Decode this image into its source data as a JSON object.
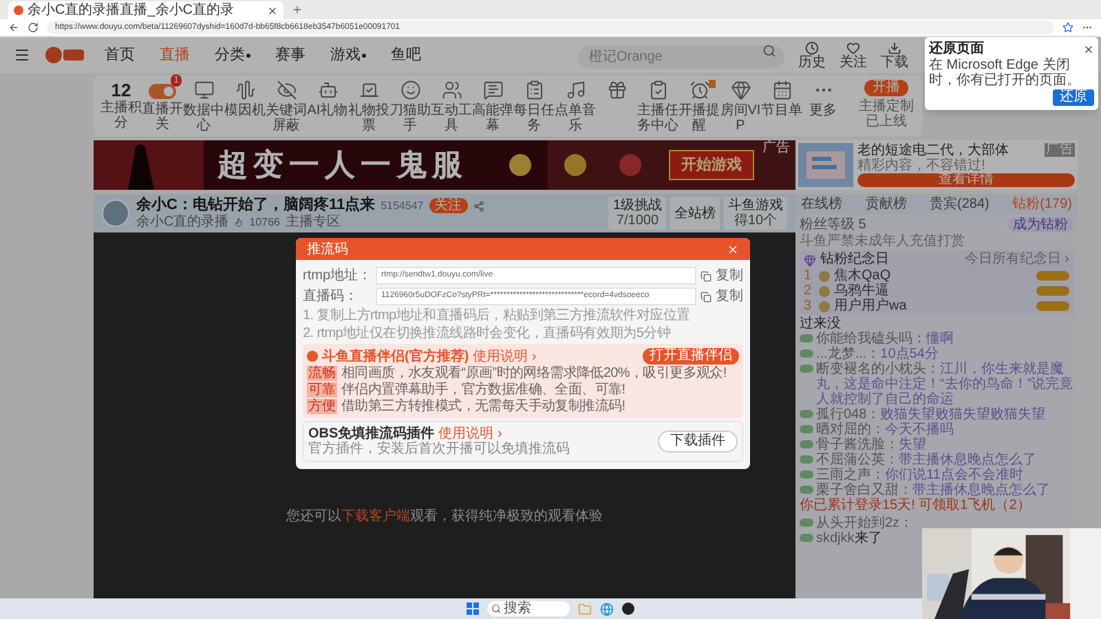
{
  "browser": {
    "tab_title": "余小C直的录播直播_余小C直的录",
    "address": "https://www.douyu.com/beta/11269607dyshid=160d7d-bb65f8cb6618eb3547b6051e00091701"
  },
  "restore_popup": {
    "title": "还原页面",
    "message": "在 Microsoft Edge 关闭时，你有已打开的页面。",
    "button": "还原"
  },
  "nav": {
    "items": [
      {
        "label": "首页",
        "selected": false,
        "has_menu": false
      },
      {
        "label": "直播",
        "selected": true,
        "has_menu": false
      },
      {
        "label": "分类",
        "selected": false,
        "has_menu": true
      },
      {
        "label": "赛事",
        "selected": false,
        "has_menu": false
      },
      {
        "label": "游戏",
        "selected": false,
        "has_menu": true
      },
      {
        "label": "鱼吧",
        "selected": false,
        "has_menu": false
      }
    ],
    "search": {
      "placeholder": "橙记Orange"
    },
    "actions": [
      "历史",
      "关注",
      "下载"
    ]
  },
  "tools": {
    "score": "12",
    "score_label": "主播积分",
    "items": [
      {
        "kind": "toggle",
        "label": "直播开关",
        "badge": "1",
        "on": true
      },
      {
        "kind": "icon",
        "label": "数据中心"
      },
      {
        "kind": "icon",
        "label": "模因机"
      },
      {
        "kind": "icon",
        "label": "关键词屏蔽"
      },
      {
        "kind": "icon",
        "label": "AI礼物"
      },
      {
        "kind": "icon",
        "label": "礼物投票"
      },
      {
        "kind": "icon",
        "label": "刀猫助手"
      },
      {
        "kind": "icon",
        "label": "互动工具"
      },
      {
        "kind": "icon",
        "label": "高能弹幕"
      },
      {
        "kind": "icon",
        "label": "每日任务"
      },
      {
        "kind": "icon",
        "label": "点单音乐"
      },
      {
        "kind": "icon"
      },
      {
        "kind": "icon",
        "label": "主播任务中心"
      },
      {
        "kind": "icon",
        "label": "开播提醒",
        "flag": true
      },
      {
        "kind": "icon",
        "label": "房间VIP"
      },
      {
        "kind": "icon",
        "label": "节目单"
      },
      {
        "kind": "icon",
        "label": "更多"
      }
    ],
    "live_button": "开播",
    "live_note": "主播定制已上线"
  },
  "banner": {
    "title": "超变一人一鬼服",
    "button": "开始游戏",
    "tag": "广告"
  },
  "side_ad": {
    "title": "老的短途电二代，大部体",
    "subtitle": "精彩内容，不容错过!",
    "button": "查看详情",
    "tag": "广告"
  },
  "streamer": {
    "title": "余小C：电钻开始了，脑阔疼11点来",
    "room": "5154547",
    "follow": "关注",
    "fan_club": "余小C直的录播",
    "hot": "10766",
    "category": "主播专区",
    "stats": [
      {
        "top": "1级挑战",
        "bottom": "7/1000"
      },
      {
        "top": "全站榜"
      },
      {
        "top": "斗鱼游戏",
        "bottom": "得10个"
      }
    ]
  },
  "video_note": {
    "before": "您还可以",
    "link": "下载客户端",
    "after": "观看，获得纯净极致的观看体验"
  },
  "modal": {
    "title": "推流码",
    "fields": [
      {
        "label": "rtmp地址：",
        "value": "rtmp://sendtw1.douyu.com/live",
        "copy": "复制"
      },
      {
        "label": "直播码：",
        "value": "1126960r5uDOFzCo?styPRt=*****************************ecord=4vdsoeeco",
        "copy": "复制"
      }
    ],
    "notes": [
      "1. 复制上方rtmp地址和直播码后，粘贴到第三方推流软件对应位置",
      "2. rtmp地址仅在切换推流线路时会变化，直播码有效期为5分钟"
    ],
    "companion": {
      "title": "斗鱼直播伴侣(官方推荐)",
      "help": "使用说明 ›",
      "button": "打开直播伴侣",
      "features": [
        {
          "tag": "流畅",
          "text": "相同画质，水友观看“原画”时的网络需求降低20%，吸引更多观众!"
        },
        {
          "tag": "可靠",
          "text": "伴侣内置弹幕助手，官方数据准确、全面、可靠!"
        },
        {
          "tag": "方便",
          "text": "借助第三方转推模式，无需每天手动复制推流码!"
        }
      ]
    },
    "obs": {
      "title": "OBS免填推流码插件",
      "help": "使用说明 ›",
      "text": "官方插件，安装后首次开播可以免填推流码",
      "button": "下载插件"
    }
  },
  "sidebar": {
    "tabs": [
      {
        "label": "在线榜",
        "selected": false
      },
      {
        "label": "贡献榜",
        "selected": false
      },
      {
        "label": "贵宾(284)",
        "selected": false
      },
      {
        "label": "钻粉(179)",
        "selected": true
      }
    ],
    "fan_level": "粉丝等级 5",
    "notice": "斗鱼严禁未成年人充值打赏",
    "join_button": "成为钻粉",
    "anniversary": {
      "title": "钻粉纪念日",
      "link": "今日所有纪念日 ›",
      "rows": [
        {
          "rank": "1",
          "name": "焦木QaQ"
        },
        {
          "rank": "2",
          "name": "乌鸦牛逼"
        },
        {
          "rank": "3",
          "name": "用户用户wa"
        }
      ]
    },
    "chat": [
      {
        "kind": "plain",
        "text": "过来没"
      },
      {
        "kind": "message",
        "name": "你能给我磕头吗：",
        "text": "懂啊"
      },
      {
        "kind": "message",
        "name": "...龙梦...：",
        "text": "10点54分"
      },
      {
        "kind": "message",
        "name": "断变褪名的小枕头：",
        "text": "江川，你生来就是魔丸，这是命中注定！“去你的鸟命！”说完竟人就控制了自己的命运"
      },
      {
        "kind": "message",
        "name": "孤行048：",
        "text": "败猫失望败猫失望败猫失望"
      },
      {
        "kind": "message",
        "name": "晒对屈的：",
        "text": "今天不播吗"
      },
      {
        "kind": "message",
        "name": "骨子酱洗脸：",
        "text": "失望"
      },
      {
        "kind": "message",
        "name": "不屈蒲公英：",
        "text": "带主播休息晚点怎么了"
      },
      {
        "kind": "message",
        "name": "三雨之声：",
        "text": "你们说11点会不会准时"
      },
      {
        "kind": "message",
        "name": "栗子舍白又甜：",
        "text": "带主播休息晚点怎么了"
      },
      {
        "kind": "notice",
        "text": "你已累计登录15天! 可领取1飞机（2）"
      }
    ],
    "chat_beside_camera": [
      {
        "name": "从头开始到2z："
      },
      {
        "name": "skdjkk",
        "text": "来了"
      }
    ]
  },
  "taskbar": {
    "search": "搜索"
  }
}
